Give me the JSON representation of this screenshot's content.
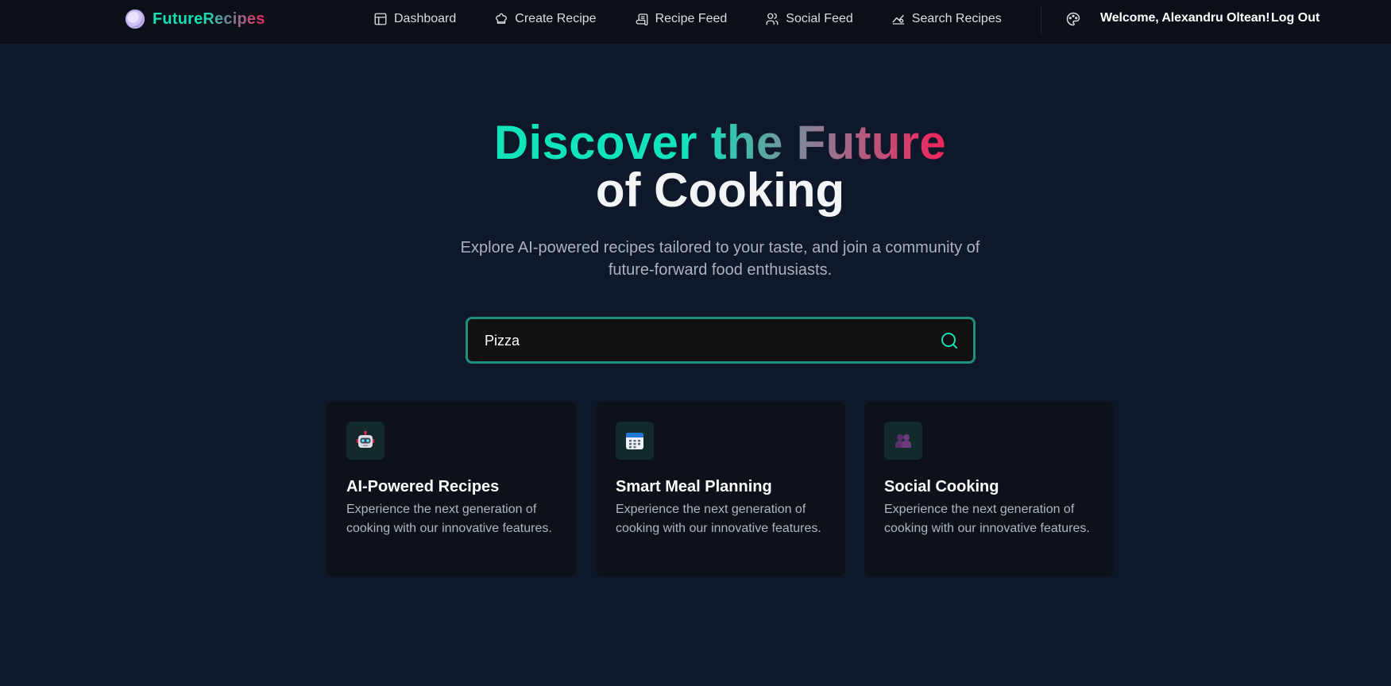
{
  "brand": {
    "name": "FutureRecipes",
    "logo_icon": "plate-icon"
  },
  "nav": {
    "items": [
      {
        "label": "Dashboard",
        "icon": "dashboard-icon"
      },
      {
        "label": "Create Recipe",
        "icon": "chef-hat-icon"
      },
      {
        "label": "Recipe Feed",
        "icon": "scroll-icon"
      },
      {
        "label": "Social Feed",
        "icon": "users-icon"
      },
      {
        "label": "Search Recipes",
        "icon": "chart-search-icon"
      }
    ],
    "theme_icon": "palette-icon",
    "welcome": "Welcome, Alexandru Oltean!",
    "logout": "Log Out"
  },
  "hero": {
    "title_line1": "Discover the Future",
    "title_line2": "of Cooking",
    "subtitle": "Explore AI-powered recipes tailored to your taste, and join a community of future-forward food enthusiasts."
  },
  "search": {
    "value": "Pizza",
    "placeholder": "",
    "icon": "search-icon"
  },
  "features": [
    {
      "icon": "robot-icon",
      "title": "AI-Powered Recipes",
      "description": "Experience the next generation of cooking with our innovative features."
    },
    {
      "icon": "calendar-icon",
      "title": "Smart Meal Planning",
      "description": "Experience the next generation of cooking with our innovative features."
    },
    {
      "icon": "people-icon",
      "title": "Social Cooking",
      "description": "Experience the next generation of cooking with our innovative features."
    }
  ],
  "colors": {
    "background": "#0f172a",
    "navbar": "#0b0f17",
    "accent": "#14e0b4",
    "accent_pink": "#f2235a",
    "card": "#0d111a"
  }
}
